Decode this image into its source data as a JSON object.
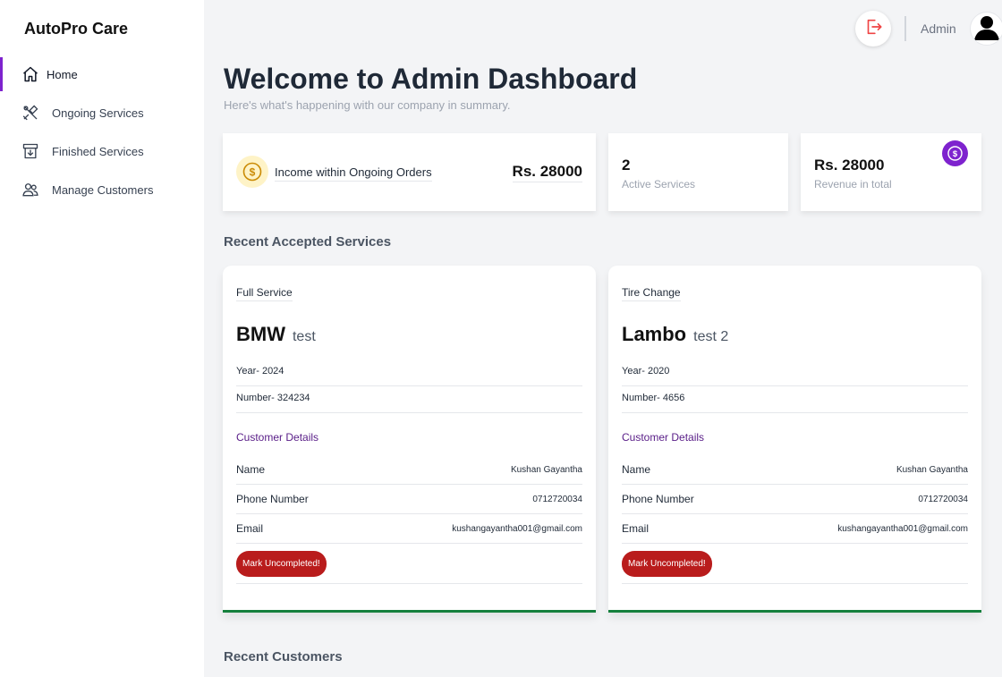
{
  "app": {
    "brand": "AutoPro Care"
  },
  "sidebar": {
    "items": [
      {
        "label": "Home",
        "icon": "home-icon",
        "active": true
      },
      {
        "label": "Ongoing Services",
        "icon": "tools-icon",
        "active": false
      },
      {
        "label": "Finished Services",
        "icon": "archive-icon",
        "active": false
      },
      {
        "label": "Manage Customers",
        "icon": "users-icon",
        "active": false
      }
    ]
  },
  "topbar": {
    "user_label": "Admin",
    "logout_icon": "logout-icon",
    "avatar_icon": "user-avatar-icon"
  },
  "header": {
    "title": "Welcome to Admin Dashboard",
    "subtitle": "Here's what's happening with our company in summary."
  },
  "stats": {
    "income": {
      "label": "Income within Ongoing Orders",
      "value": "Rs. 28000",
      "icon": "coin-icon"
    },
    "active": {
      "value": "2",
      "label": "Active Services"
    },
    "revenue": {
      "value": "Rs. 28000",
      "label": "Revenue in total",
      "icon": "dollar-badge-icon"
    }
  },
  "sections": {
    "recent_services": "Recent Accepted Services",
    "recent_customers": "Recent Customers"
  },
  "services": [
    {
      "type": "Full Service",
      "make": "BMW",
      "model": "test",
      "year": "Year- 2024",
      "number": "Number- 324234",
      "customer_title": "Customer Details",
      "name_label": "Name",
      "name": "Kushan Gayantha",
      "phone_label": "Phone Number",
      "phone": "0712720034",
      "email_label": "Email",
      "email": "kushangayantha001@gmail.com",
      "button": "Mark Uncompleted!"
    },
    {
      "type": "Tire Change",
      "make": "Lambo",
      "model": "test 2",
      "year": "Year- 2020",
      "number": "Number- 4656",
      "customer_title": "Customer Details",
      "name_label": "Name",
      "name": "Kushan Gayantha",
      "phone_label": "Phone Number",
      "phone": "0712720034",
      "email_label": "Email",
      "email": "kushangayantha001@gmail.com",
      "button": "Mark Uncompleted!"
    }
  ],
  "colors": {
    "accent": "#7e22ce",
    "danger": "#b91c1c",
    "success": "#15803d",
    "coin": "#eab308"
  }
}
